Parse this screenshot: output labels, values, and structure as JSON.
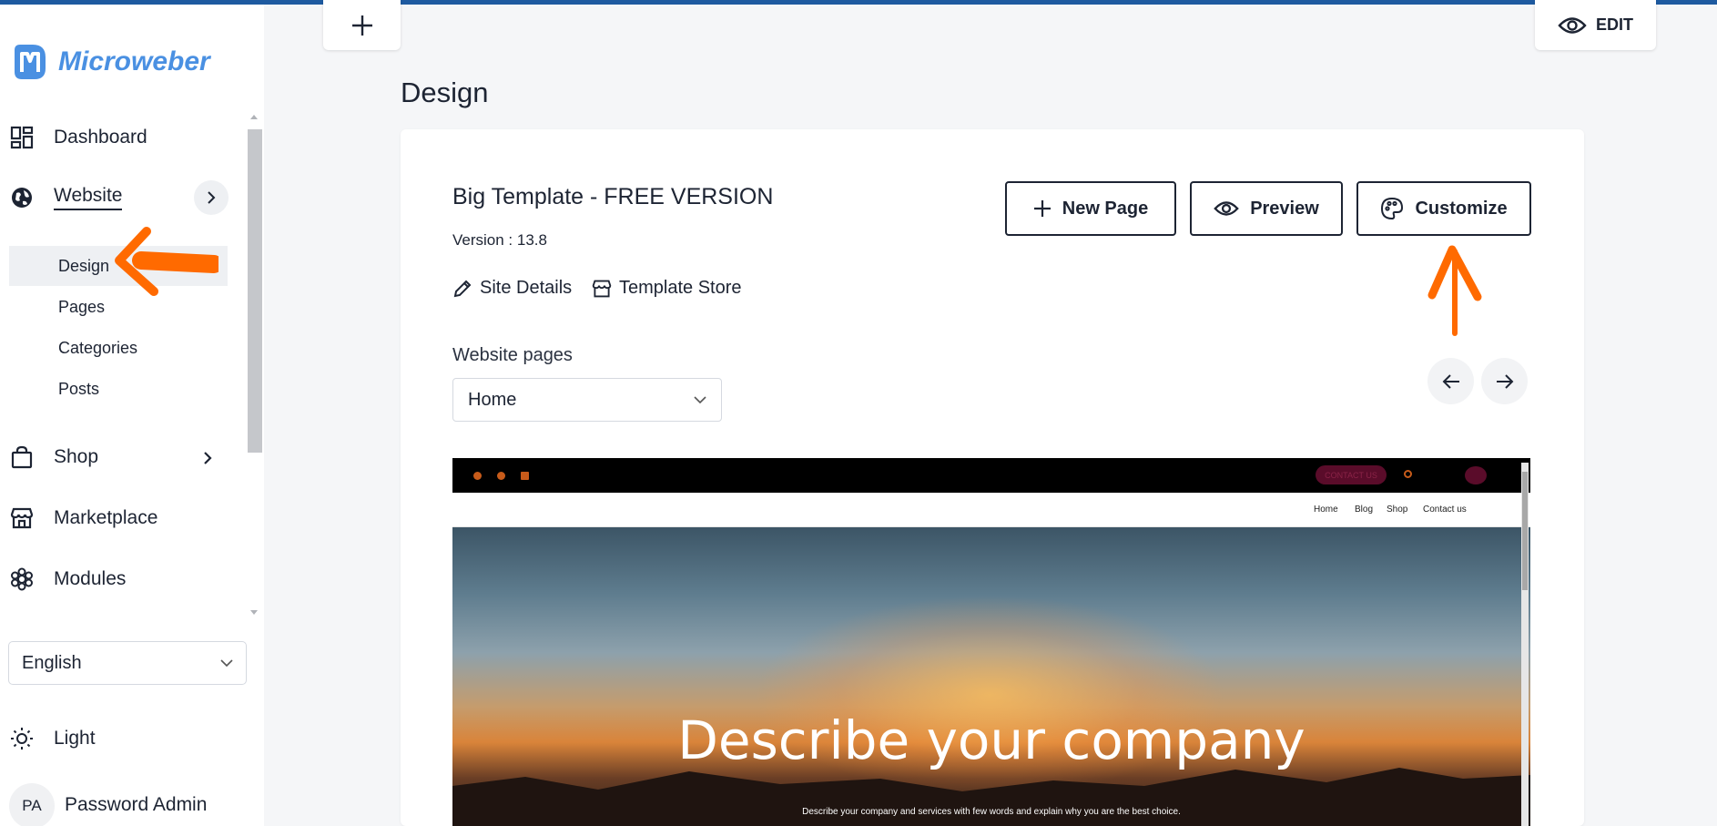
{
  "brand": {
    "name": "Microweber",
    "accent": "#4a90e2"
  },
  "sidebar": {
    "items": [
      {
        "label": "Dashboard",
        "icon": "dashboard-icon"
      },
      {
        "label": "Website",
        "icon": "globe-icon"
      },
      {
        "label": "Shop",
        "icon": "shopping-bag-icon"
      },
      {
        "label": "Marketplace",
        "icon": "store-icon"
      },
      {
        "label": "Modules",
        "icon": "modules-icon"
      }
    ],
    "website_sub": [
      "Design",
      "Pages",
      "Categories",
      "Posts"
    ],
    "language": "English",
    "theme": "Light",
    "user": {
      "initials": "PA",
      "name": "Password Admin"
    }
  },
  "toolbar": {
    "edit_label": "EDIT"
  },
  "main": {
    "title": "Design",
    "template_title": "Big Template - FREE VERSION",
    "version": "Version : 13.8",
    "site_details": "Site Details",
    "template_store": "Template Store",
    "new_page": "New Page",
    "preview": "Preview",
    "customize": "Customize",
    "pages_label": "Website pages",
    "pages_selected": "Home"
  },
  "preview": {
    "contact_btn": "CONTACT US",
    "nav": [
      "Home",
      "Blog",
      "Shop",
      "Contact us"
    ],
    "hero_title": "Describe your company",
    "hero_sub": "Describe your company and services with few words and explain why you are the best choice."
  },
  "colors": {
    "annotation": "#ff6a00",
    "topbar": "#1e5aa0"
  }
}
